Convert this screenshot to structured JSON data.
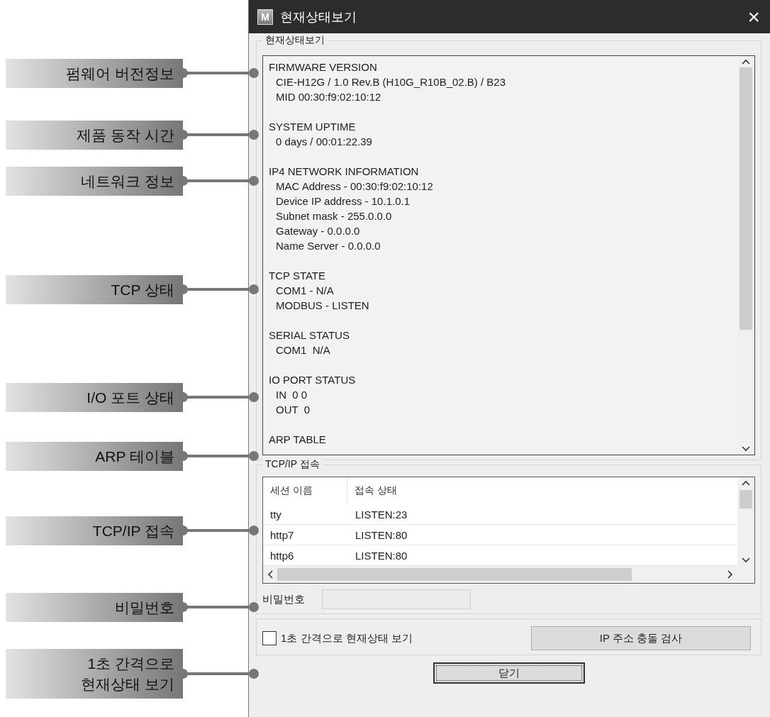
{
  "callouts": [
    {
      "lines": [
        "펌웨어 버전정보"
      ]
    },
    {
      "lines": [
        "제품 동작 시간"
      ]
    },
    {
      "lines": [
        "네트워크 정보"
      ]
    },
    {
      "lines": [
        "TCP 상태"
      ]
    },
    {
      "lines": [
        "I/O 포트 상태"
      ]
    },
    {
      "lines": [
        "ARP 테이블"
      ]
    },
    {
      "lines": [
        "TCP/IP 접속"
      ]
    },
    {
      "lines": [
        "비밀번호"
      ]
    },
    {
      "lines": [
        "1초 간격으로",
        "현재상태 보기"
      ]
    }
  ],
  "window": {
    "icon": "M",
    "title": "현재상태보기",
    "close": "×"
  },
  "status_group": {
    "title": "현재상태보기",
    "sections": [
      {
        "heading": "FIRMWARE VERSION",
        "lines": [
          "CIE-H12G / 1.0 Rev.B (H10G_R10B_02.B) / B23",
          "MID 00:30:f9:02:10:12"
        ]
      },
      {
        "heading": "SYSTEM UPTIME",
        "lines": [
          "0 days / 00:01:22.39"
        ]
      },
      {
        "heading": "IP4 NETWORK INFORMATION",
        "lines": [
          "MAC Address - 00:30:f9:02:10:12",
          "Device IP address - 10.1.0.1",
          "Subnet mask - 255.0.0.0",
          "Gateway - 0.0.0.0",
          "Name Server - 0.0.0.0"
        ]
      },
      {
        "heading": "TCP STATE",
        "lines": [
          "COM1 - N/A",
          "MODBUS - LISTEN"
        ]
      },
      {
        "heading": "SERIAL STATUS",
        "lines": [
          "COM1  N/A"
        ]
      },
      {
        "heading": "IO PORT STATUS",
        "lines": [
          "IN  0 0",
          "OUT  0"
        ]
      },
      {
        "heading": "ARP TABLE"
      }
    ]
  },
  "tcp_group": {
    "title": "TCP/IP 접속",
    "columns": [
      "세션 이름",
      "접속 상태"
    ],
    "rows": [
      [
        "tty",
        "LISTEN:23"
      ],
      [
        "http7",
        "LISTEN:80"
      ],
      [
        "http6",
        "LISTEN:80"
      ]
    ],
    "password_label": "비밀번호",
    "password_disabled": true
  },
  "options": {
    "checkbox": {
      "label": "1초 간격으로 현재상태 보기",
      "checked": false
    },
    "button": "IP 주소 충돌 검사"
  },
  "close_button": "닫기"
}
